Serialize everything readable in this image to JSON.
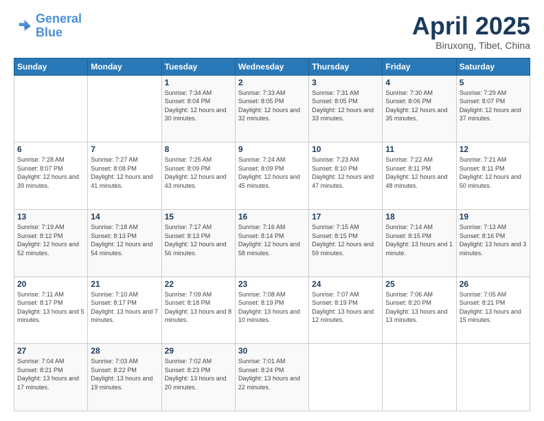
{
  "logo": {
    "line1": "General",
    "line2": "Blue"
  },
  "title": "April 2025",
  "subtitle": "Biruxong, Tibet, China",
  "days_of_week": [
    "Sunday",
    "Monday",
    "Tuesday",
    "Wednesday",
    "Thursday",
    "Friday",
    "Saturday"
  ],
  "weeks": [
    [
      {
        "day": "",
        "info": ""
      },
      {
        "day": "",
        "info": ""
      },
      {
        "day": "1",
        "info": "Sunrise: 7:34 AM\nSunset: 8:04 PM\nDaylight: 12 hours and 30 minutes."
      },
      {
        "day": "2",
        "info": "Sunrise: 7:33 AM\nSunset: 8:05 PM\nDaylight: 12 hours and 32 minutes."
      },
      {
        "day": "3",
        "info": "Sunrise: 7:31 AM\nSunset: 8:05 PM\nDaylight: 12 hours and 33 minutes."
      },
      {
        "day": "4",
        "info": "Sunrise: 7:30 AM\nSunset: 8:06 PM\nDaylight: 12 hours and 35 minutes."
      },
      {
        "day": "5",
        "info": "Sunrise: 7:29 AM\nSunset: 8:07 PM\nDaylight: 12 hours and 37 minutes."
      }
    ],
    [
      {
        "day": "6",
        "info": "Sunrise: 7:28 AM\nSunset: 8:07 PM\nDaylight: 12 hours and 39 minutes."
      },
      {
        "day": "7",
        "info": "Sunrise: 7:27 AM\nSunset: 8:08 PM\nDaylight: 12 hours and 41 minutes."
      },
      {
        "day": "8",
        "info": "Sunrise: 7:25 AM\nSunset: 8:09 PM\nDaylight: 12 hours and 43 minutes."
      },
      {
        "day": "9",
        "info": "Sunrise: 7:24 AM\nSunset: 8:09 PM\nDaylight: 12 hours and 45 minutes."
      },
      {
        "day": "10",
        "info": "Sunrise: 7:23 AM\nSunset: 8:10 PM\nDaylight: 12 hours and 47 minutes."
      },
      {
        "day": "11",
        "info": "Sunrise: 7:22 AM\nSunset: 8:11 PM\nDaylight: 12 hours and 48 minutes."
      },
      {
        "day": "12",
        "info": "Sunrise: 7:21 AM\nSunset: 8:11 PM\nDaylight: 12 hours and 50 minutes."
      }
    ],
    [
      {
        "day": "13",
        "info": "Sunrise: 7:19 AM\nSunset: 8:12 PM\nDaylight: 12 hours and 52 minutes."
      },
      {
        "day": "14",
        "info": "Sunrise: 7:18 AM\nSunset: 8:13 PM\nDaylight: 12 hours and 54 minutes."
      },
      {
        "day": "15",
        "info": "Sunrise: 7:17 AM\nSunset: 8:13 PM\nDaylight: 12 hours and 56 minutes."
      },
      {
        "day": "16",
        "info": "Sunrise: 7:16 AM\nSunset: 8:14 PM\nDaylight: 12 hours and 58 minutes."
      },
      {
        "day": "17",
        "info": "Sunrise: 7:15 AM\nSunset: 8:15 PM\nDaylight: 12 hours and 59 minutes."
      },
      {
        "day": "18",
        "info": "Sunrise: 7:14 AM\nSunset: 8:15 PM\nDaylight: 13 hours and 1 minute."
      },
      {
        "day": "19",
        "info": "Sunrise: 7:13 AM\nSunset: 8:16 PM\nDaylight: 13 hours and 3 minutes."
      }
    ],
    [
      {
        "day": "20",
        "info": "Sunrise: 7:11 AM\nSunset: 8:17 PM\nDaylight: 13 hours and 5 minutes."
      },
      {
        "day": "21",
        "info": "Sunrise: 7:10 AM\nSunset: 8:17 PM\nDaylight: 13 hours and 7 minutes."
      },
      {
        "day": "22",
        "info": "Sunrise: 7:09 AM\nSunset: 8:18 PM\nDaylight: 13 hours and 8 minutes."
      },
      {
        "day": "23",
        "info": "Sunrise: 7:08 AM\nSunset: 8:19 PM\nDaylight: 13 hours and 10 minutes."
      },
      {
        "day": "24",
        "info": "Sunrise: 7:07 AM\nSunset: 8:19 PM\nDaylight: 13 hours and 12 minutes."
      },
      {
        "day": "25",
        "info": "Sunrise: 7:06 AM\nSunset: 8:20 PM\nDaylight: 13 hours and 13 minutes."
      },
      {
        "day": "26",
        "info": "Sunrise: 7:05 AM\nSunset: 8:21 PM\nDaylight: 13 hours and 15 minutes."
      }
    ],
    [
      {
        "day": "27",
        "info": "Sunrise: 7:04 AM\nSunset: 8:21 PM\nDaylight: 13 hours and 17 minutes."
      },
      {
        "day": "28",
        "info": "Sunrise: 7:03 AM\nSunset: 8:22 PM\nDaylight: 13 hours and 19 minutes."
      },
      {
        "day": "29",
        "info": "Sunrise: 7:02 AM\nSunset: 8:23 PM\nDaylight: 13 hours and 20 minutes."
      },
      {
        "day": "30",
        "info": "Sunrise: 7:01 AM\nSunset: 8:24 PM\nDaylight: 13 hours and 22 minutes."
      },
      {
        "day": "",
        "info": ""
      },
      {
        "day": "",
        "info": ""
      },
      {
        "day": "",
        "info": ""
      }
    ]
  ]
}
